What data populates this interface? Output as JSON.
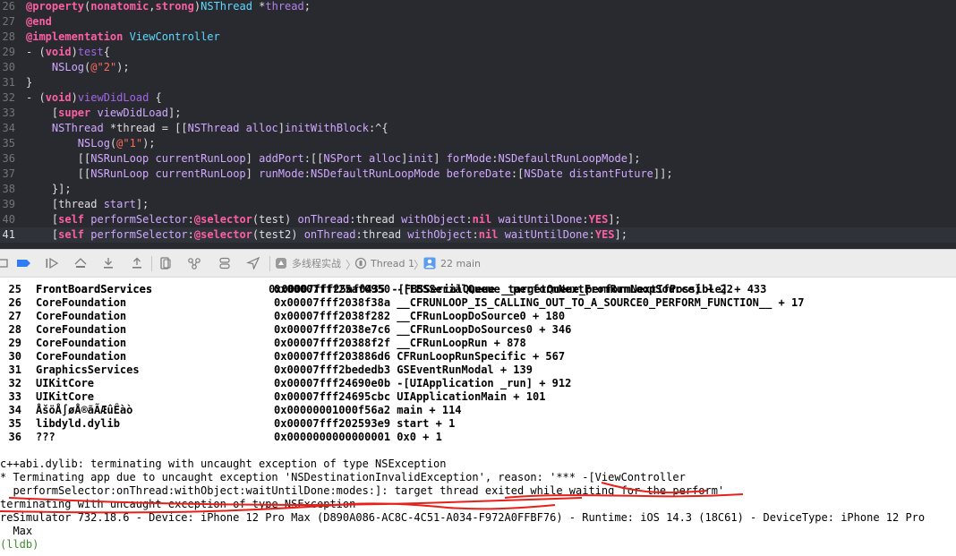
{
  "editor": {
    "lines": [
      {
        "num": "26",
        "tokens": [
          {
            "c": "kw",
            "t": "@property"
          },
          {
            "c": "tx",
            "t": "("
          },
          {
            "c": "kw",
            "t": "nonatomic"
          },
          {
            "c": "tx",
            "t": ","
          },
          {
            "c": "kw",
            "t": "strong"
          },
          {
            "c": "tx",
            "t": ")"
          },
          {
            "c": "cls",
            "t": "NSThread"
          },
          {
            "c": "tx",
            "t": " *"
          },
          {
            "c": "ob",
            "t": "thread"
          },
          {
            "c": "tx",
            "t": ";"
          }
        ]
      },
      {
        "num": "27",
        "tokens": [
          {
            "c": "kw",
            "t": "@end"
          }
        ]
      },
      {
        "num": "28",
        "tokens": [
          {
            "c": "kw",
            "t": "@implementation"
          },
          {
            "c": "tx",
            "t": " "
          },
          {
            "c": "cls",
            "t": "ViewController"
          }
        ]
      },
      {
        "num": "29",
        "tokens": [
          {
            "c": "tx",
            "t": "- ("
          },
          {
            "c": "kw",
            "t": "void"
          },
          {
            "c": "tx",
            "t": ")"
          },
          {
            "c": "fn",
            "t": "test"
          },
          {
            "c": "tx",
            "t": "{"
          }
        ]
      },
      {
        "num": "30",
        "tokens": [
          {
            "c": "tx",
            "t": "    "
          },
          {
            "c": "ty",
            "t": "NSLog"
          },
          {
            "c": "tx",
            "t": "("
          },
          {
            "c": "str",
            "t": "@\"2\""
          },
          {
            "c": "tx",
            "t": ");"
          }
        ]
      },
      {
        "num": "31",
        "tokens": [
          {
            "c": "tx",
            "t": "}"
          }
        ]
      },
      {
        "num": "32",
        "tokens": [
          {
            "c": "tx",
            "t": "- ("
          },
          {
            "c": "kw",
            "t": "void"
          },
          {
            "c": "tx",
            "t": ")"
          },
          {
            "c": "fn",
            "t": "viewDidLoad"
          },
          {
            "c": "tx",
            "t": " {"
          }
        ]
      },
      {
        "num": "33",
        "tokens": [
          {
            "c": "tx",
            "t": "    ["
          },
          {
            "c": "kw",
            "t": "super"
          },
          {
            "c": "tx",
            "t": " "
          },
          {
            "c": "ty",
            "t": "viewDidLoad"
          },
          {
            "c": "tx",
            "t": "];"
          }
        ]
      },
      {
        "num": "34",
        "tokens": [
          {
            "c": "tx",
            "t": "    "
          },
          {
            "c": "ty",
            "t": "NSThread"
          },
          {
            "c": "tx",
            "t": " *thread = [["
          },
          {
            "c": "ty",
            "t": "NSThread"
          },
          {
            "c": "tx",
            "t": " "
          },
          {
            "c": "ty",
            "t": "alloc"
          },
          {
            "c": "tx",
            "t": "]"
          },
          {
            "c": "ty",
            "t": "initWithBlock"
          },
          {
            "c": "tx",
            "t": ":^{"
          }
        ]
      },
      {
        "num": "35",
        "tokens": [
          {
            "c": "tx",
            "t": "        "
          },
          {
            "c": "ty",
            "t": "NSLog"
          },
          {
            "c": "tx",
            "t": "("
          },
          {
            "c": "str",
            "t": "@\"1\""
          },
          {
            "c": "tx",
            "t": ");"
          }
        ]
      },
      {
        "num": "36",
        "tokens": [
          {
            "c": "tx",
            "t": "        [["
          },
          {
            "c": "ty",
            "t": "NSRunLoop"
          },
          {
            "c": "tx",
            "t": " "
          },
          {
            "c": "ty",
            "t": "currentRunLoop"
          },
          {
            "c": "tx",
            "t": "] "
          },
          {
            "c": "ty",
            "t": "addPort"
          },
          {
            "c": "tx",
            "t": ":[["
          },
          {
            "c": "ty",
            "t": "NSPort"
          },
          {
            "c": "tx",
            "t": " "
          },
          {
            "c": "ty",
            "t": "alloc"
          },
          {
            "c": "tx",
            "t": "]"
          },
          {
            "c": "ty",
            "t": "init"
          },
          {
            "c": "tx",
            "t": "] "
          },
          {
            "c": "ty",
            "t": "forMode"
          },
          {
            "c": "tx",
            "t": ":"
          },
          {
            "c": "ty",
            "t": "NSDefaultRunLoopMode"
          },
          {
            "c": "tx",
            "t": "];"
          }
        ]
      },
      {
        "num": "37",
        "tokens": [
          {
            "c": "tx",
            "t": "        [["
          },
          {
            "c": "ty",
            "t": "NSRunLoop"
          },
          {
            "c": "tx",
            "t": " "
          },
          {
            "c": "ty",
            "t": "currentRunLoop"
          },
          {
            "c": "tx",
            "t": "] "
          },
          {
            "c": "ty",
            "t": "runMode"
          },
          {
            "c": "tx",
            "t": ":"
          },
          {
            "c": "ty",
            "t": "NSDefaultRunLoopMode"
          },
          {
            "c": "tx",
            "t": " "
          },
          {
            "c": "ty",
            "t": "beforeDate"
          },
          {
            "c": "tx",
            "t": ":["
          },
          {
            "c": "ty",
            "t": "NSDate"
          },
          {
            "c": "tx",
            "t": " "
          },
          {
            "c": "ty",
            "t": "distantFuture"
          },
          {
            "c": "tx",
            "t": "]];"
          }
        ]
      },
      {
        "num": "38",
        "tokens": [
          {
            "c": "tx",
            "t": "    }];"
          }
        ]
      },
      {
        "num": "39",
        "tokens": [
          {
            "c": "tx",
            "t": "    [thread "
          },
          {
            "c": "ty",
            "t": "start"
          },
          {
            "c": "tx",
            "t": "];"
          }
        ]
      },
      {
        "num": "40",
        "tokens": [
          {
            "c": "tx",
            "t": "    ["
          },
          {
            "c": "kw",
            "t": "self"
          },
          {
            "c": "tx",
            "t": " "
          },
          {
            "c": "ty",
            "t": "performSelector"
          },
          {
            "c": "tx",
            "t": ":"
          },
          {
            "c": "kw",
            "t": "@selector"
          },
          {
            "c": "tx",
            "t": "(test) "
          },
          {
            "c": "ty",
            "t": "onThread"
          },
          {
            "c": "tx",
            "t": ":thread "
          },
          {
            "c": "ty",
            "t": "withObject"
          },
          {
            "c": "tx",
            "t": ":"
          },
          {
            "c": "kw",
            "t": "nil"
          },
          {
            "c": "tx",
            "t": " "
          },
          {
            "c": "ty",
            "t": "waitUntilDone"
          },
          {
            "c": "tx",
            "t": ":"
          },
          {
            "c": "kw",
            "t": "YES"
          },
          {
            "c": "tx",
            "t": "];"
          }
        ]
      },
      {
        "num": "41",
        "current": true,
        "tokens": [
          {
            "c": "tx",
            "t": "    ["
          },
          {
            "c": "kw",
            "t": "self"
          },
          {
            "c": "tx",
            "t": " "
          },
          {
            "c": "ty",
            "t": "performSelector"
          },
          {
            "c": "tx",
            "t": ":"
          },
          {
            "c": "kw",
            "t": "@selector"
          },
          {
            "c": "tx",
            "t": "(test2) "
          },
          {
            "c": "ty",
            "t": "onThread"
          },
          {
            "c": "tx",
            "t": ":thread "
          },
          {
            "c": "ty",
            "t": "withObject"
          },
          {
            "c": "tx",
            "t": ":"
          },
          {
            "c": "kw",
            "t": "nil"
          },
          {
            "c": "tx",
            "t": " "
          },
          {
            "c": "ty",
            "t": "waitUntilDone"
          },
          {
            "c": "tx",
            "t": ":"
          },
          {
            "c": "kw",
            "t": "YES"
          },
          {
            "c": "tx",
            "t": "];"
          }
        ]
      }
    ]
  },
  "debug_bar": {
    "breadcrumb_project": "多线程实战",
    "breadcrumb_thread": "Thread 1",
    "breadcrumb_frame": "22 main",
    "icons": [
      "breakpoints-toggle-icon",
      "continue-icon",
      "step-over-icon",
      "step-into-icon",
      "step-out-icon",
      "view-hierarchy-icon",
      "memory-graph-icon",
      "environment-overrides-icon",
      "simulate-location-icon"
    ]
  },
  "console": {
    "partial_line": "FrontBoardServices                  0x00007fff25af0435 -[FBSSerialQueue _targetQueue_performNextIfPossible] + 433",
    "frames": [
      {
        "num": "25",
        "lib": "FrontBoardServices",
        "addr": "0x00007fff25af0950 -[FBSSerialQueue _performNextFromRunLoopSource] + 22"
      },
      {
        "num": "26",
        "lib": "CoreFoundation",
        "addr": "0x00007fff2038f38a __CFRUNLOOP_IS_CALLING_OUT_TO_A_SOURCE0_PERFORM_FUNCTION__ + 17"
      },
      {
        "num": "27",
        "lib": "CoreFoundation",
        "addr": "0x00007fff2038f282 __CFRunLoopDoSource0 + 180"
      },
      {
        "num": "28",
        "lib": "CoreFoundation",
        "addr": "0x00007fff2038e7c6 __CFRunLoopDoSources0 + 346"
      },
      {
        "num": "29",
        "lib": "CoreFoundation",
        "addr": "0x00007fff20388f2f __CFRunLoopRun + 878"
      },
      {
        "num": "30",
        "lib": "CoreFoundation",
        "addr": "0x00007fff203886d6 CFRunLoopRunSpecific + 567"
      },
      {
        "num": "31",
        "lib": "GraphicsServices",
        "addr": "0x00007fff2bededb3 GSEventRunModal + 139"
      },
      {
        "num": "32",
        "lib": "UIKitCore",
        "addr": "0x00007fff24690e0b -[UIApplication _run] + 912"
      },
      {
        "num": "33",
        "lib": "UIKitCore",
        "addr": "0x00007fff24695cbc UIApplicationMain + 101"
      },
      {
        "num": "34",
        "lib": "ÅšöÅ∫øÅ®ãÃÆûÊàò",
        "addr": "0x00000001000f56a2 main + 114"
      },
      {
        "num": "35",
        "lib": "libdyld.dylib",
        "addr": "0x00007fff202593e9 start + 1"
      },
      {
        "num": "36",
        "lib": "???",
        "addr": "0x0000000000000001 0x0 + 1"
      }
    ],
    "messages": [
      "c++abi.dylib: terminating with uncaught exception of type NSException",
      "* Terminating app due to uncaught exception 'NSDestinationInvalidException', reason: '*** -[ViewController",
      "  performSelector:onThread:withObject:waitUntilDone:modes:]: target thread exited while waiting for the perform'",
      "terminating with uncaught exception of type NSException",
      "reSimulator 732.18.6 - Device: iPhone 12 Pro Max (D890A086-AC8C-4C51-A034-F972A0FFBF76) - Runtime: iOS 14.3 (18C61) - DeviceType: iPhone 12 Pro",
      "  Max",
      "(lldb)"
    ],
    "markup_color": "#e8201a"
  },
  "colors": {
    "editor_bg": "#292a30",
    "console_bg": "#ffffff",
    "bar_bg": "#ececec",
    "active_icon": "#2f7cf6"
  }
}
